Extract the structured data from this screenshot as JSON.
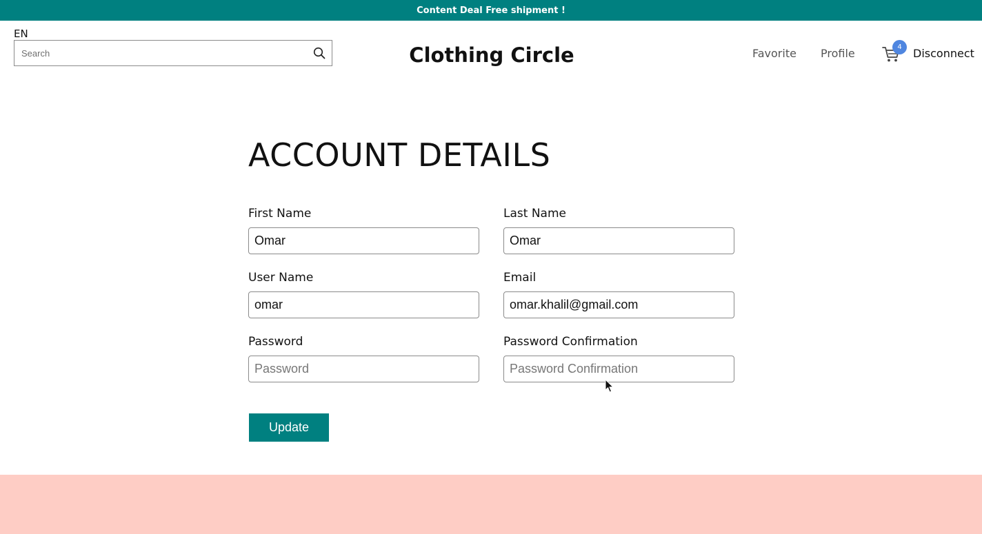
{
  "promo": {
    "text": "Content Deal Free shipment !"
  },
  "header": {
    "language": "EN",
    "search": {
      "placeholder": "Search",
      "value": ""
    },
    "brand": "Clothing Circle",
    "nav": {
      "favorite": "Favorite",
      "profile": "Profile",
      "disconnect": "Disconnect"
    },
    "cart": {
      "count": "4"
    }
  },
  "main": {
    "title": "ACCOUNT DETAILS",
    "form": {
      "first_name": {
        "label": "First Name",
        "value": "Omar"
      },
      "last_name": {
        "label": "Last Name",
        "value": "Omar"
      },
      "user_name": {
        "label": "User Name",
        "value": "omar"
      },
      "email": {
        "label": "Email",
        "value": "omar.khalil@gmail.com"
      },
      "password": {
        "label": "Password",
        "placeholder": "Password",
        "value": ""
      },
      "password_confirmation": {
        "label": "Password Confirmation",
        "placeholder": "Password Confirmation",
        "value": ""
      },
      "update_label": "Update"
    }
  },
  "icons": {
    "search": "search-icon",
    "cart": "cart-icon",
    "cursor": "mouse-cursor"
  },
  "colors": {
    "accent": "#008080",
    "badge": "#4f86e0",
    "footer": "#fecdc5"
  }
}
